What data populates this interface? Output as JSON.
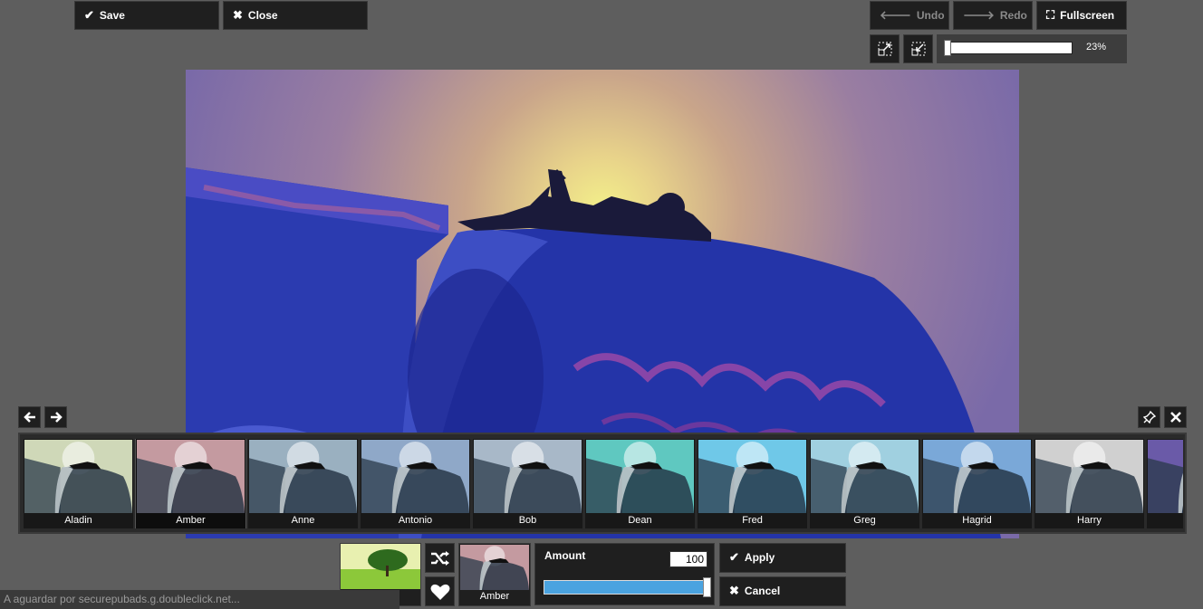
{
  "toolbar": {
    "save_label": "Save",
    "close_label": "Close",
    "undo_label": "Undo",
    "redo_label": "Redo",
    "fullscreen_label": "Fullscreen"
  },
  "zoom": {
    "value_text": "23%",
    "level": 0.23
  },
  "icons": {
    "check": "check-icon",
    "close": "x-icon",
    "undo": "arrow-left-icon",
    "redo": "arrow-right-icon",
    "fullscreen": "fullscreen-icon",
    "shrink": "shrink-icon",
    "fit": "fit-icon",
    "pin": "pin-icon",
    "shuffle": "shuffle-icon",
    "heart": "heart-icon"
  },
  "filters": [
    {
      "label": "Aladin",
      "tint": "#cfd8b8"
    },
    {
      "label": "Amber",
      "tint": "#c49aa0"
    },
    {
      "label": "Anne",
      "tint": "#9ab0c0"
    },
    {
      "label": "Antonio",
      "tint": "#8fa8c8"
    },
    {
      "label": "Bob",
      "tint": "#a8b8c8"
    },
    {
      "label": "Dean",
      "tint": "#5fc8c0"
    },
    {
      "label": "Fred",
      "tint": "#6fc8e8"
    },
    {
      "label": "Greg",
      "tint": "#a0d0e0"
    },
    {
      "label": "Hagrid",
      "tint": "#7aa8d8"
    },
    {
      "label": "Harry",
      "tint": "#d0d0d0"
    }
  ],
  "selected_filter": {
    "label": "Amber"
  },
  "amount": {
    "label": "Amount",
    "value": "100",
    "level": 1.0
  },
  "actions": {
    "apply_label": "Apply",
    "cancel_label": "Cancel"
  },
  "status": {
    "text": "A aguardar por securepubads.g.doubleclick.net..."
  }
}
